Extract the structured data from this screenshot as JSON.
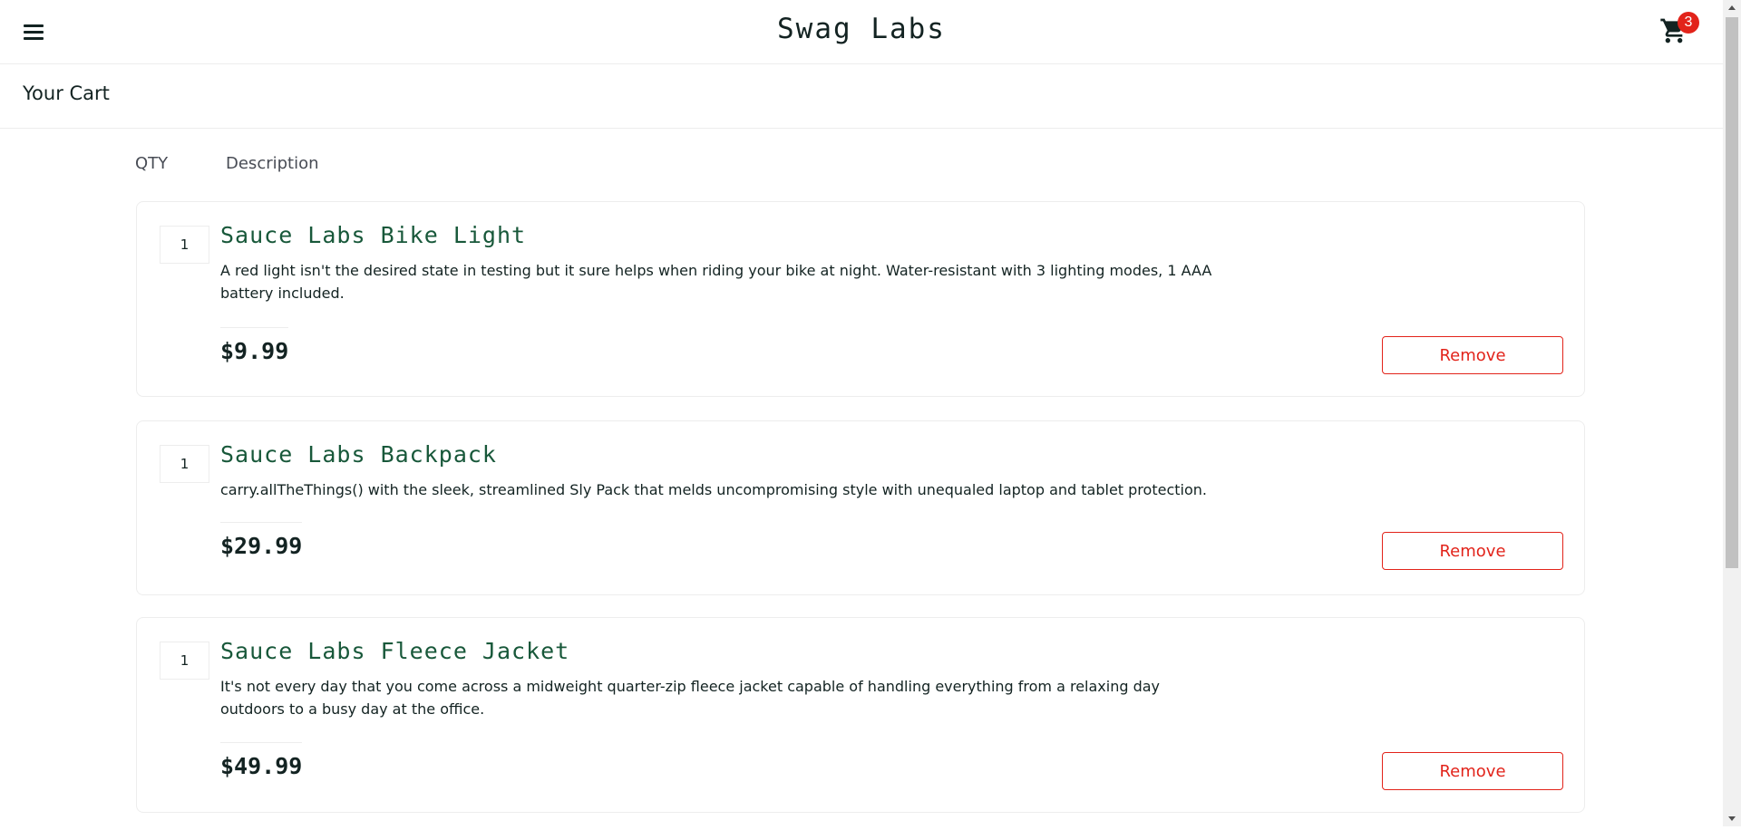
{
  "header": {
    "logo": "Swag Labs",
    "cart_badge": "3",
    "menu_icon": "hamburger-menu-icon",
    "cart_icon": "shopping-cart-icon"
  },
  "page": {
    "title": "Your Cart"
  },
  "columns": {
    "qty": "QTY",
    "description": "Description"
  },
  "items": [
    {
      "qty": "1",
      "name": "Sauce Labs Bike Light",
      "description": "A red light isn't the desired state in testing but it sure helps when riding your bike at night. Water-resistant with 3 lighting modes, 1 AAA battery included.",
      "price": "$9.99",
      "remove_label": "Remove"
    },
    {
      "qty": "1",
      "name": "Sauce Labs Backpack",
      "description": "carry.allTheThings() with the sleek, streamlined Sly Pack that melds uncompromising style with unequaled laptop and tablet protection.",
      "price": "$29.99",
      "remove_label": "Remove"
    },
    {
      "qty": "1",
      "name": "Sauce Labs Fleece Jacket",
      "description": "It's not every day that you come across a midweight quarter-zip fleece jacket capable of handling everything from a relaxing day outdoors to a busy day at the office.",
      "price": "$49.99",
      "remove_label": "Remove"
    }
  ],
  "colors": {
    "accent_red": "#e2231a",
    "item_name_green": "#18583a",
    "text": "#132322",
    "border": "#ededed"
  }
}
